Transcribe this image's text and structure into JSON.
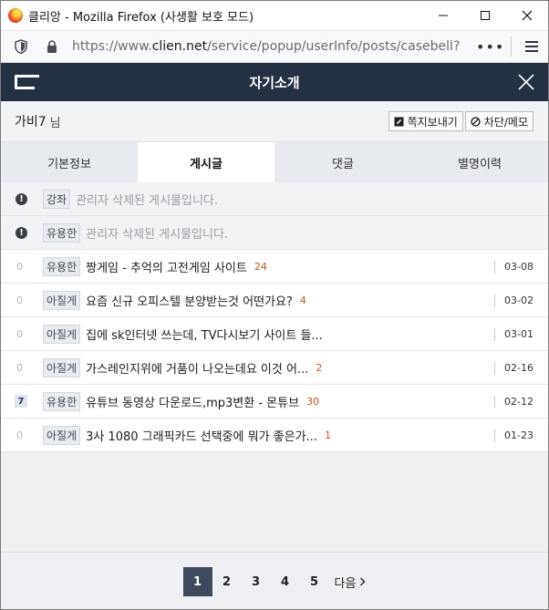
{
  "window": {
    "title": "클리앙 - Mozilla Firefox (사생활 보호 모드)",
    "url_prefix": "https://www.",
    "url_domain": "clien.net",
    "url_path": "/service/popup/userInfo/posts/casebell?",
    "more_label": "•••"
  },
  "popup": {
    "title": "자기소개"
  },
  "user": {
    "name": "가비7",
    "suffix": "님",
    "message_button": "쪽지보내기",
    "block_button": "차단/메모"
  },
  "tabs": [
    {
      "label": "기본정보",
      "active": false
    },
    {
      "label": "게시글",
      "active": true
    },
    {
      "label": "댓글",
      "active": false
    },
    {
      "label": "별명이력",
      "active": false
    }
  ],
  "posts": [
    {
      "num": "",
      "category": "강좌",
      "subject": "관리자 삭제된 게시물입니다.",
      "comments": "",
      "date": "",
      "deleted": true
    },
    {
      "num": "",
      "category": "유용한",
      "subject": "관리자 삭제된 게시물입니다.",
      "comments": "",
      "date": "",
      "deleted": true
    },
    {
      "num": "0",
      "category": "유용한",
      "subject": "짱게임 - 추억의 고전게임 사이트",
      "comments": "24",
      "date": "03-08",
      "deleted": false
    },
    {
      "num": "0",
      "category": "아질게",
      "subject": "요즘 신규 오피스텔 분양받는것 어떤가요?",
      "comments": "4",
      "date": "03-02",
      "deleted": false
    },
    {
      "num": "0",
      "category": "아질게",
      "subject": "집에 sk인터넷 쓰는데, TV다시보기 사이트 들...",
      "comments": "",
      "date": "03-01",
      "deleted": false
    },
    {
      "num": "0",
      "category": "아질게",
      "subject": "가스레인지위에 거품이 나오는데요 이것 어...",
      "comments": "2",
      "date": "02-16",
      "deleted": false
    },
    {
      "num": "7",
      "category": "유용한",
      "subject": "유튜브 동영상 다운로드,mp3변환 - 몬튜브",
      "comments": "30",
      "date": "02-12",
      "deleted": false
    },
    {
      "num": "0",
      "category": "아질게",
      "subject": "3사 1080 그래픽카드 선택중에 뭐가 좋은가...",
      "comments": "1",
      "date": "01-23",
      "deleted": false
    }
  ],
  "pager": {
    "pages": [
      "1",
      "2",
      "3",
      "4",
      "5"
    ],
    "active": "1",
    "next_label": "다음"
  }
}
